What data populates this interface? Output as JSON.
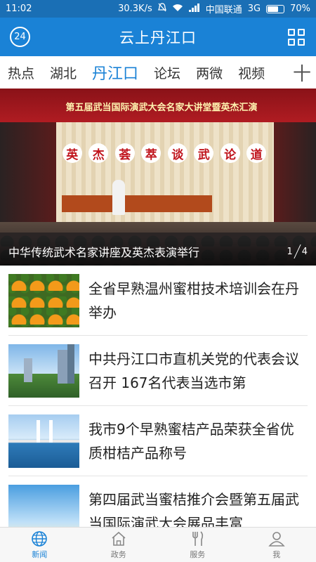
{
  "status_bar": {
    "time": "11:02",
    "speed": "30.3K/s",
    "carrier": "中国联通",
    "network": "3G",
    "battery": "70%",
    "battery_level": 0.7
  },
  "header": {
    "badge": "24",
    "title": "云上丹江口"
  },
  "tabs": {
    "items": [
      "热点",
      "湖北",
      "丹江口",
      "论坛",
      "两微",
      "视频"
    ],
    "active_index": 2,
    "more": "十"
  },
  "hero": {
    "banner": "第五届武当国际演武大会名家大讲堂暨英杰汇演",
    "slogan": [
      "英",
      "杰",
      "荟",
      "萃",
      "谈",
      "武",
      "论",
      "道"
    ],
    "caption": "中华传统武术名家讲座及英杰表演举行",
    "page_current": "1",
    "page_total": "4"
  },
  "news": [
    {
      "title": "全省早熟温州蜜柑技术培训会在丹举办",
      "thumb": "oranges"
    },
    {
      "title": "中共丹江口市直机关党的代表会议召开  167名代表当选市第",
      "thumb": "city"
    },
    {
      "title": "我市9个早熟蜜桔产品荣获全省优质柑桔产品称号",
      "thumb": "bridge"
    },
    {
      "title": "第四届武当蜜桔推介会暨第五届武当国际演武大会展品丰富",
      "thumb": "sky"
    }
  ],
  "bottom_nav": [
    {
      "label": "新闻",
      "icon": "globe-icon",
      "active": true
    },
    {
      "label": "政务",
      "icon": "home-icon",
      "active": false
    },
    {
      "label": "服务",
      "icon": "cutlery-icon",
      "active": false
    },
    {
      "label": "我",
      "icon": "user-icon",
      "active": false
    }
  ],
  "colors": {
    "accent": "#1a82d6",
    "status_bar": "#1a6fb5"
  }
}
